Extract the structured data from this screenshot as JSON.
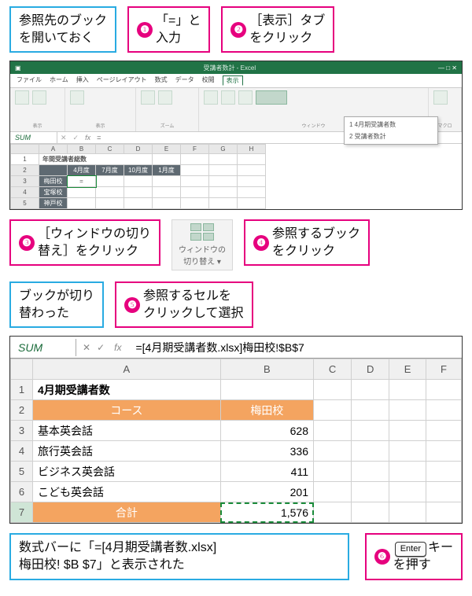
{
  "callouts": {
    "blue1": "参照先のブック\nを開いておく",
    "pink1": {
      "n": "❶",
      "t": "「=」と\n入力"
    },
    "pink2": {
      "n": "❷",
      "t": "［表示］タブ\nをクリック"
    },
    "pink3": {
      "n": "❸",
      "t": "［ウィンドウの切り\n替え］をクリック"
    },
    "pink4": {
      "n": "❹",
      "t": "参照するブック\nをクリック"
    },
    "blue2": "ブックが切り\n替わった",
    "pink5": {
      "n": "❺",
      "t": "参照するセルを\nクリックして選択"
    },
    "blue3": "数式バーに「=[4月期受講者数.xlsx]\n梅田校! $B $7」と表示された",
    "pink6": {
      "n": "❻",
      "key": "Enter",
      "t": "キー\nを押す"
    }
  },
  "switch_chip": "ウィンドウの\n切り替え ▾",
  "excel1": {
    "title_right": "受講者数計 - Excel",
    "tabs": [
      "ファイル",
      "ホーム",
      "挿入",
      "ページレイアウト",
      "数式",
      "データ",
      "校閲",
      "表示"
    ],
    "group_view": "表示",
    "group_zoom": "ズーム",
    "group_window": "ウィンドウ",
    "group_macro": "マクロ",
    "switch_btn": "ウィンドウの\n切り替え",
    "dropdown": [
      "1 4月期受講者数",
      "2 受講者数計"
    ],
    "name_box": "SUM",
    "fx": "fx",
    "formula": "=",
    "mini_title": "年間受講者総数",
    "mini_cols": [
      "",
      "4月度",
      "7月度",
      "10月度",
      "1月度"
    ],
    "mini_rows": [
      "梅田校",
      "宝塚校",
      "神戸校"
    ]
  },
  "excel2": {
    "name_box": "SUM",
    "btn_x": "✕",
    "btn_v": "✓",
    "fx": "fx",
    "formula": "=[4月期受講者数.xlsx]梅田校!$B$7",
    "cols": [
      "",
      "A",
      "B",
      "C",
      "D",
      "E",
      "F"
    ],
    "title": "4月期受講者数",
    "header_row": [
      "コース",
      "梅田校"
    ],
    "rows": [
      {
        "a": "基本英会話",
        "b": "628"
      },
      {
        "a": "旅行英会話",
        "b": "336"
      },
      {
        "a": "ビジネス英会話",
        "b": "411"
      },
      {
        "a": "こども英会話",
        "b": "201"
      }
    ],
    "total_label": "合計",
    "total_value": "1,576"
  },
  "chart_data": {
    "type": "table",
    "title": "4月期受講者数（梅田校）",
    "categories": [
      "基本英会話",
      "旅行英会話",
      "ビジネス英会話",
      "こども英会話",
      "合計"
    ],
    "values": [
      628,
      336,
      411,
      201,
      1576
    ]
  }
}
